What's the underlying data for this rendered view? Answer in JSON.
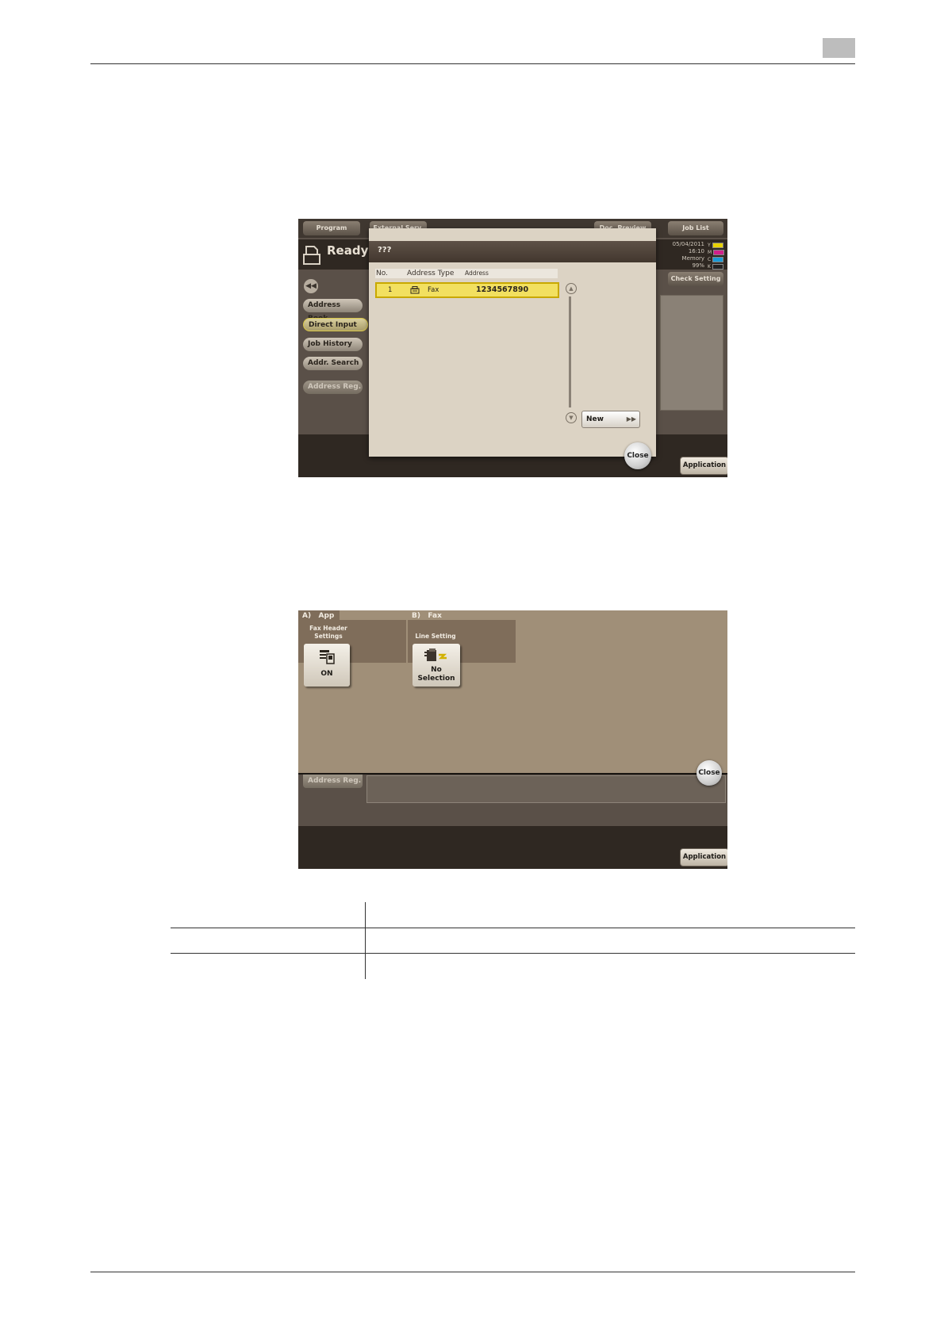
{
  "screen1": {
    "toolbar": {
      "program": "Program",
      "external": "External Serv.",
      "doc_preview": "Doc. Preview",
      "job_list": "Job List"
    },
    "status": {
      "ready": "Ready to",
      "date": "05/04/2011",
      "time": "16:10",
      "memory_label": "Memory",
      "memory_value": "99%",
      "check_setting": "Check Setting",
      "toners": [
        {
          "label": "Y",
          "color": "#e8d200"
        },
        {
          "label": "M",
          "color": "#d0208a"
        },
        {
          "label": "C",
          "color": "#1a9ad6"
        },
        {
          "label": "K",
          "color": "#222222"
        }
      ]
    },
    "sidebar": {
      "items": [
        {
          "label": "Address Book"
        },
        {
          "label": "Direct Input"
        },
        {
          "label": "Job History"
        },
        {
          "label": "Addr. Search"
        },
        {
          "label": "Address Reg."
        }
      ]
    },
    "dialog": {
      "title": "???",
      "columns": {
        "no": "No.",
        "type": "Address Type",
        "address": "Address"
      },
      "rows": [
        {
          "no": "1",
          "type": "Fax",
          "address": "1234567890"
        }
      ],
      "new_button": "New",
      "close_button": "Close"
    },
    "application_button": "Application"
  },
  "screen2": {
    "groups": [
      {
        "header": "A)   App",
        "sub": "Fax Header Settings",
        "sub1": "Fax Header",
        "sub2": "Settings",
        "value": "ON"
      },
      {
        "header": "B)   Fax",
        "sub": "Line Setting",
        "value1": "No",
        "value2": "Selection"
      }
    ],
    "address_reg": "Address Reg.",
    "close_button": "Close",
    "application_button": "Application"
  }
}
